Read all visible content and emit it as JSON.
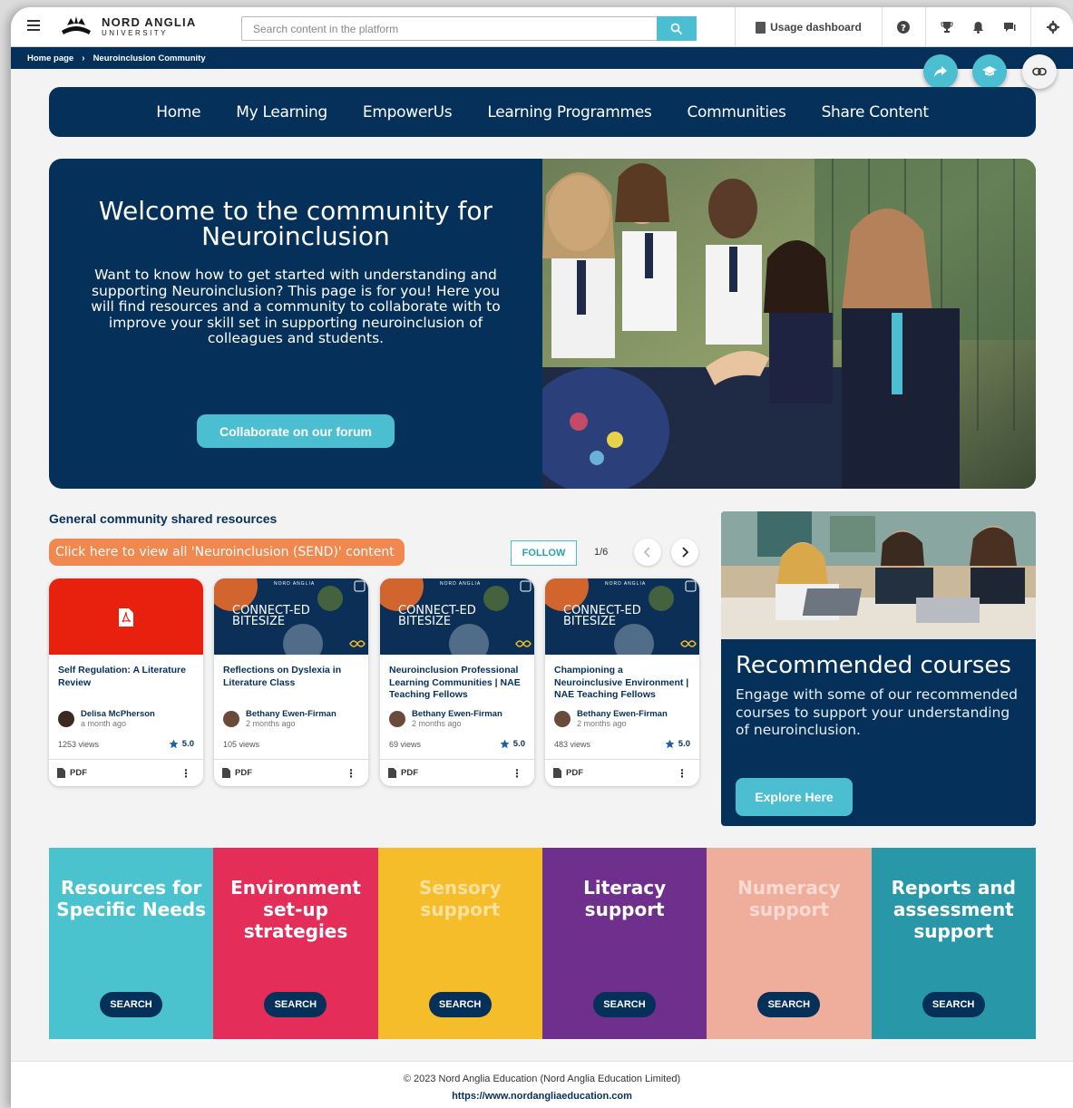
{
  "header": {
    "logo_line1": "NORD ANGLIA",
    "logo_line2": "UNIVERSITY",
    "search_placeholder": "Search content in the platform",
    "usage_label": "Usage dashboard"
  },
  "breadcrumb": {
    "home": "Home page",
    "separator": "›",
    "current": "Neuroinclusion Community"
  },
  "nav": [
    "Home",
    "My Learning",
    "EmpowerUs",
    "Learning Programmes",
    "Communities",
    "Share Content"
  ],
  "hero": {
    "title": "Welcome to the community for Neuroinclusion",
    "description": "Want to know how to get started with understanding and supporting Neuroinclusion? This page is for you! Here you will find resources and a community to collaborate with to improve your skill set in supporting neuroinclusion of colleagues and students.",
    "button": "Collaborate on our forum"
  },
  "resources": {
    "title": "General community shared resources",
    "view_all": "Click here to view all 'Neuroinclusion (SEND)' content",
    "follow": "FOLLOW",
    "page": "1/6",
    "thumb_text_1": "CONNECT-ED",
    "thumb_text_2": "BITESIZE",
    "thumb_brand": "NORD ANGLIA",
    "cards": [
      {
        "title": "Self Regulation: A Literature Review",
        "author": "Delisa McPherson",
        "time": "a month ago",
        "views": "1253 views",
        "rating": "5.0",
        "type": "PDF"
      },
      {
        "title": "Reflections on Dyslexia in Literature Class",
        "author": "Bethany Ewen-Firman",
        "time": "2 months ago",
        "views": "105 views",
        "rating": "",
        "type": "PDF"
      },
      {
        "title": "Neuroinclusion Professional Learning Communities | NAE Teaching Fellows",
        "author": "Bethany Ewen-Firman",
        "time": "2 months ago",
        "views": "69 views",
        "rating": "5.0",
        "type": "PDF"
      },
      {
        "title": "Championing a Neuroinclusive Environment | NAE Teaching Fellows",
        "author": "Bethany Ewen-Firman",
        "time": "2 months ago",
        "views": "483 views",
        "rating": "5.0",
        "type": "PDF"
      }
    ]
  },
  "recommended": {
    "title": "Recommended courses",
    "description": "Engage with some of our recommended courses to support your understanding of neuroinclusion.",
    "button": "Explore Here"
  },
  "tiles": [
    {
      "title": "Resources for Specific Needs",
      "button": "SEARCH",
      "color": "#4ac3cf"
    },
    {
      "title": "Environment set-up strategies",
      "button": "SEARCH",
      "color": "#e52d5a"
    },
    {
      "title": "Sensory support",
      "button": "SEARCH",
      "color": "#f5bd2a"
    },
    {
      "title": "Literacy support",
      "button": "SEARCH",
      "color": "#6e2f8d"
    },
    {
      "title": "Numeracy support",
      "button": "SEARCH",
      "color": "#efae9c"
    },
    {
      "title": "Reports and assessment support",
      "button": "SEARCH",
      "color": "#2898a8"
    }
  ],
  "footer": {
    "copyright": "© 2023 Nord Anglia Education (Nord Anglia Education Limited)",
    "url": "https://www.nordangliaeducation.com"
  },
  "colors": {
    "navy": "#053059",
    "teal": "#4bbfd1",
    "orange": "#f0884f",
    "pdf_red": "#e8210e"
  },
  "icons": [
    "menu-icon",
    "search-icon",
    "clipboard-icon",
    "help-icon",
    "trophy-icon",
    "bell-icon",
    "chat-icon",
    "settings-icon",
    "share-icon",
    "graduation-cap-icon",
    "link-icon",
    "pdf-icon",
    "star-icon",
    "chevron-left-icon",
    "chevron-right-icon",
    "more-vertical-icon"
  ]
}
